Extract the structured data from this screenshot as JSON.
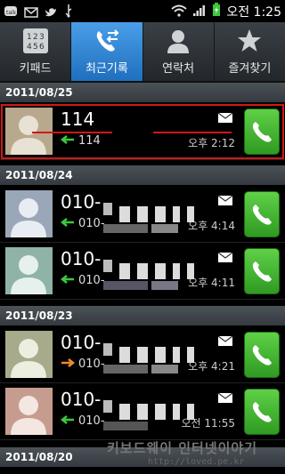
{
  "status_bar": {
    "time": "오전 1:25"
  },
  "tabs": [
    {
      "label": "키패드",
      "icon": "keypad-icon",
      "active": false
    },
    {
      "label": "최근기록",
      "icon": "call-log-icon",
      "active": true
    },
    {
      "label": "연락처",
      "icon": "contact-icon",
      "active": false
    },
    {
      "label": "즐겨찾기",
      "icon": "star-icon",
      "active": false
    }
  ],
  "groups": [
    {
      "date": "2011/08/25",
      "entries": [
        {
          "name": "114",
          "number": "114",
          "time": "오후 2:12",
          "direction": "incoming"
        }
      ]
    },
    {
      "date": "2011/08/24",
      "entries": [
        {
          "name": "010-",
          "number": "010-",
          "time": "오후 4:14",
          "direction": "incoming"
        },
        {
          "name": "010-",
          "number": "010-",
          "time": "오후 4:11",
          "direction": "incoming"
        }
      ]
    },
    {
      "date": "2011/08/23",
      "entries": [
        {
          "name": "010-",
          "number": "010-",
          "time": "오후 4:21",
          "direction": "outgoing"
        },
        {
          "name": "010-",
          "number": "010-",
          "time": "오전 11:55",
          "direction": "incoming"
        }
      ]
    },
    {
      "date": "2011/08/20",
      "entries": []
    }
  ],
  "watermark": {
    "text": "키보드웨이  인터넷이야기",
    "url": "http://loved.pe.kr"
  },
  "colors": {
    "incoming": "#3cc83c",
    "outgoing": "#f08a2a",
    "highlight": "#d01818",
    "call": "#3fae2e"
  }
}
